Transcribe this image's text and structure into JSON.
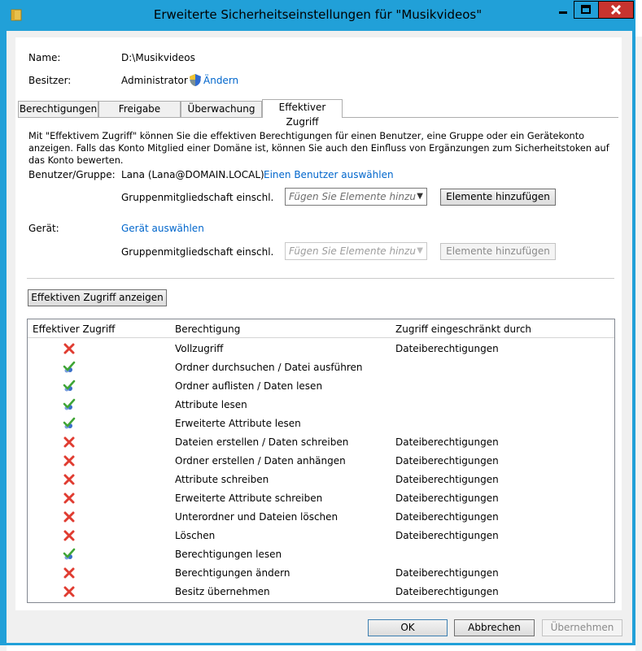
{
  "window": {
    "title": "Erweiterte Sicherheitseinstellungen für \"Musikvideos\""
  },
  "general": {
    "name_label": "Name:",
    "name_value": "D:\\Musikvideos",
    "owner_label": "Besitzer:",
    "owner_value": "Administrator",
    "change_link": "Ändern"
  },
  "tabs": [
    {
      "label": "Berechtigungen"
    },
    {
      "label": "Freigabe"
    },
    {
      "label": "Überwachung"
    },
    {
      "label": "Effektiver Zugriff",
      "active": true
    }
  ],
  "effective": {
    "description": "Mit \"Effektivem Zugriff\" können Sie die effektiven Berechtigungen für einen Benutzer, eine Gruppe oder ein Gerätekonto anzeigen. Falls das Konto Mitglied einer Domäne ist, können Sie auch den Einfluss von Ergänzungen zum Sicherheitstoken auf das Konto bewerten.",
    "user_label": "Benutzer/Gruppe:",
    "user_value": "Lana (Lana@DOMAIN.LOCAL)",
    "select_user_link": "Einen Benutzer auswählen",
    "group_membership_label": "Gruppenmitgliedschaft einschl.",
    "combo_placeholder": "Fügen Sie Elemente hinzu",
    "add_items_button": "Elemente hinzufügen",
    "device_label": "Gerät:",
    "select_device_link": "Gerät auswählen",
    "device_group_label": "Gruppenmitgliedschaft einschl.",
    "device_combo_placeholder": "Fügen Sie Elemente hinzu",
    "device_add_button": "Elemente hinzufügen",
    "show_button": "Effektiven Zugriff anzeigen"
  },
  "table": {
    "headers": [
      "Effektiver Zugriff",
      "Berechtigung",
      "Zugriff eingeschränkt durch"
    ],
    "rows": [
      {
        "access": "denied",
        "permission": "Vollzugriff",
        "limited_by": "Dateiberechtigungen"
      },
      {
        "access": "allowed",
        "permission": "Ordner durchsuchen / Datei ausführen",
        "limited_by": ""
      },
      {
        "access": "allowed",
        "permission": "Ordner auflisten / Daten lesen",
        "limited_by": ""
      },
      {
        "access": "allowed",
        "permission": "Attribute lesen",
        "limited_by": ""
      },
      {
        "access": "allowed",
        "permission": "Erweiterte Attribute lesen",
        "limited_by": ""
      },
      {
        "access": "denied",
        "permission": "Dateien erstellen / Daten schreiben",
        "limited_by": "Dateiberechtigungen"
      },
      {
        "access": "denied",
        "permission": "Ordner erstellen / Daten anhängen",
        "limited_by": "Dateiberechtigungen"
      },
      {
        "access": "denied",
        "permission": "Attribute schreiben",
        "limited_by": "Dateiberechtigungen"
      },
      {
        "access": "denied",
        "permission": "Erweiterte Attribute schreiben",
        "limited_by": "Dateiberechtigungen"
      },
      {
        "access": "denied",
        "permission": "Unterordner und Dateien löschen",
        "limited_by": "Dateiberechtigungen"
      },
      {
        "access": "denied",
        "permission": "Löschen",
        "limited_by": "Dateiberechtigungen"
      },
      {
        "access": "allowed",
        "permission": "Berechtigungen lesen",
        "limited_by": ""
      },
      {
        "access": "denied",
        "permission": "Berechtigungen ändern",
        "limited_by": "Dateiberechtigungen"
      },
      {
        "access": "denied",
        "permission": "Besitz übernehmen",
        "limited_by": "Dateiberechtigungen"
      }
    ]
  },
  "footer": {
    "ok": "OK",
    "cancel": "Abbrechen",
    "apply": "Übernehmen"
  },
  "colors": {
    "accent": "#21a0d8",
    "close": "#c7342f",
    "link": "#0066cc",
    "denied": "#e03c31",
    "allowed": "#3fa535"
  }
}
